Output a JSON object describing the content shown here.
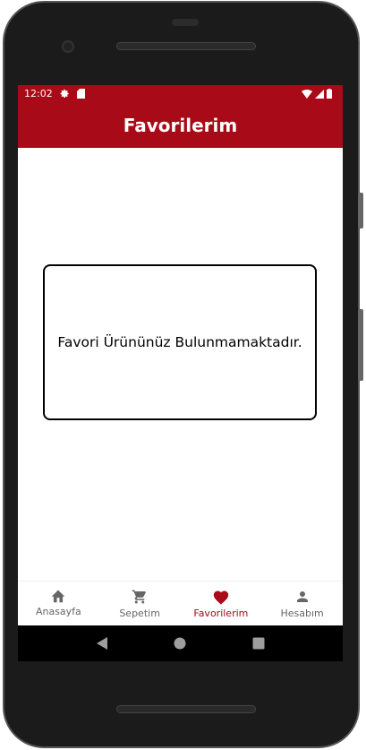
{
  "status_bar": {
    "time": "12:02",
    "icons": [
      "settings-icon",
      "sd-card-icon",
      "wifi-icon",
      "signal-icon",
      "battery-icon"
    ]
  },
  "app_bar": {
    "title": "Favorilerim"
  },
  "main": {
    "empty_message": "Favori Ürününüz Bulunmamaktadır."
  },
  "bottom_nav": {
    "items": [
      {
        "label": "Anasayfa",
        "icon": "home-icon"
      },
      {
        "label": "Sepetim",
        "icon": "cart-icon"
      },
      {
        "label": "Favorilerim",
        "icon": "heart-icon",
        "active": true
      },
      {
        "label": "Hesabım",
        "icon": "person-icon"
      }
    ]
  },
  "colors": {
    "primary": "#a80a17",
    "inactive": "#666666"
  }
}
